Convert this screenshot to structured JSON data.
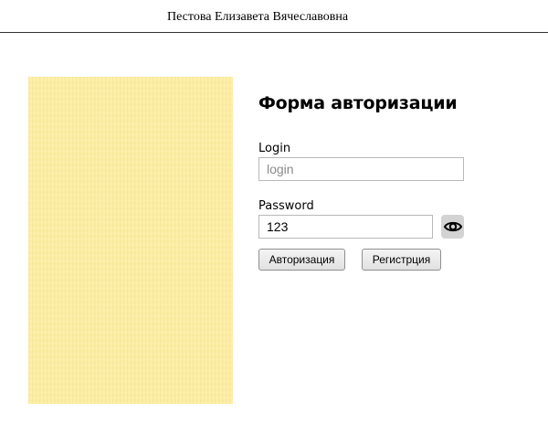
{
  "header": {
    "title": "Пестова Елизавета Вячеславовна"
  },
  "image": {
    "icon": "yellow-textured-image",
    "color": "#fdefa3"
  },
  "form": {
    "title": "Форма авторизации",
    "login": {
      "label": "Login",
      "value": "",
      "placeholder": "login"
    },
    "password": {
      "label": "Password",
      "value": "123",
      "placeholder": "",
      "toggle_icon": "eye-icon"
    },
    "buttons": {
      "login_label": "Авторизация",
      "register_label": "Регистрция"
    }
  },
  "colors": {
    "header_rule": "#333333",
    "eye_button_bg": "#d3d3d3",
    "input_border": "#b9b9b9"
  }
}
